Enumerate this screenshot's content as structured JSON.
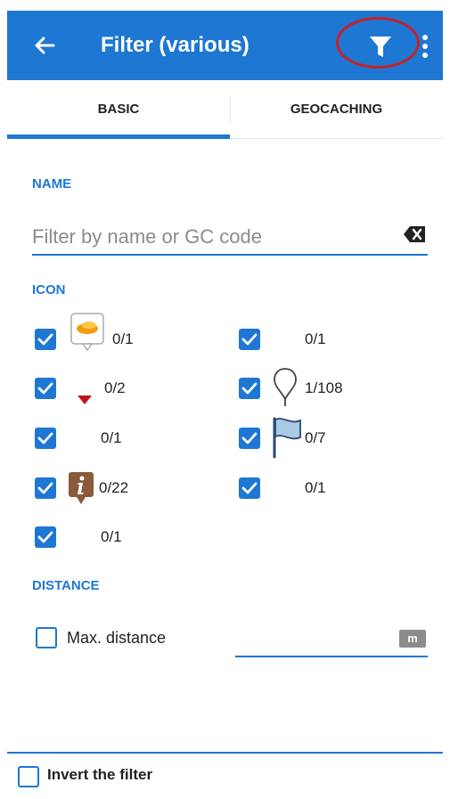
{
  "appbar": {
    "title": "Filter (various)",
    "back_icon": "arrow-left-icon",
    "filter_icon": "funnel-icon",
    "more_icon": "more-vert-icon"
  },
  "colors": {
    "primary": "#1e77d2",
    "highlight_circle": "#c62226"
  },
  "tabs": [
    {
      "label": "BASIC",
      "selected": true
    },
    {
      "label": "GEOCACHING",
      "selected": false
    }
  ],
  "name_section": {
    "label": "NAME",
    "placeholder": "Filter by name or GC code",
    "value": ""
  },
  "icon_section": {
    "label": "ICON",
    "left": [
      {
        "icon": "yellow-ring-pin-icon",
        "count": "0/1",
        "checked": true
      },
      {
        "icon": "red-triangle-icon",
        "count": "0/2",
        "checked": true
      },
      {
        "icon": "",
        "count": "0/1",
        "checked": true
      },
      {
        "icon": "info-marker-icon",
        "count": "0/22",
        "checked": true
      },
      {
        "icon": "",
        "count": "0/1",
        "checked": true
      }
    ],
    "right": [
      {
        "icon": "",
        "count": "0/1",
        "checked": true
      },
      {
        "icon": "balloon-pin-icon",
        "count": "1/108",
        "checked": true
      },
      {
        "icon": "blue-flag-icon",
        "count": "0/7",
        "checked": true
      },
      {
        "icon": "",
        "count": "0/1",
        "checked": true
      }
    ]
  },
  "distance_section": {
    "label": "DISTANCE",
    "max_distance_label": "Max. distance",
    "checked": false,
    "unit": "m",
    "value": ""
  },
  "bottom": {
    "invert_label": "Invert the filter",
    "checked": false
  }
}
